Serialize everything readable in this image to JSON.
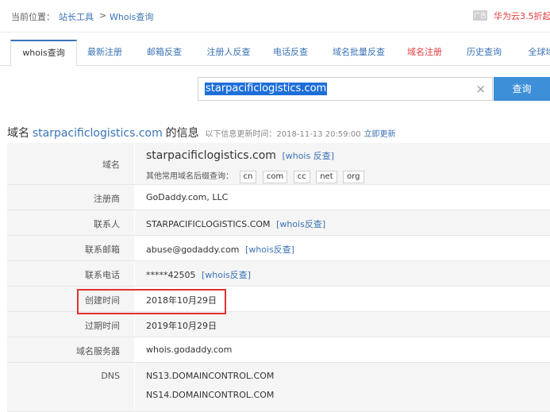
{
  "breadcrumb": {
    "label": "当前位置：",
    "link1": "站长工具",
    "sep": ">",
    "link2": "Whois查询"
  },
  "ad": {
    "badge": "广告",
    "text": "华为云3.5折起–"
  },
  "tabs": [
    {
      "label": "whois查询"
    },
    {
      "label": "最新注册"
    },
    {
      "label": "邮箱反查"
    },
    {
      "label": "注册人反查"
    },
    {
      "label": "电话反查"
    },
    {
      "label": "域名批量反查"
    },
    {
      "label": "域名注册"
    },
    {
      "label": "历史查询"
    },
    {
      "label": "全球域"
    }
  ],
  "search": {
    "value": "starpacificlogistics.com",
    "button": "查询",
    "clear": "×"
  },
  "heading": {
    "prefix": "域名",
    "domain": "starpacificlogistics.com",
    "suffix": "的信息",
    "update_text": "以下信息更新时间：2018-11-13 20:59:00",
    "update_link": "立即更新"
  },
  "table": {
    "domain": {
      "key": "域名",
      "value": "starpacificlogistics.com",
      "link": "[whois 反查]",
      "tld_label": "其他常用域名后缀查询：",
      "tlds": [
        "cn",
        "com",
        "cc",
        "net",
        "org"
      ]
    },
    "registrar": {
      "key": "注册商",
      "value": "GoDaddy.com, LLC"
    },
    "contact": {
      "key": "联系人",
      "value": "STARPACIFICLOGISTICS.COM",
      "link": "[whois反查]"
    },
    "email": {
      "key": "联系邮箱",
      "value": "abuse@godaddy.com",
      "link": "[whois反查]"
    },
    "phone": {
      "key": "联系电话",
      "value": "*****42505",
      "link": "[whois反查]"
    },
    "created": {
      "key": "创建时间",
      "value": "2018年10月29日"
    },
    "expires": {
      "key": "过期时间",
      "value": "2019年10月29日"
    },
    "server": {
      "key": "域名服务器",
      "value": "whois.godaddy.com"
    },
    "dns": {
      "key": "DNS",
      "values": [
        "NS13.DOMAINCONTROL.COM",
        "NS14.DOMAINCONTROL.COM"
      ]
    }
  }
}
